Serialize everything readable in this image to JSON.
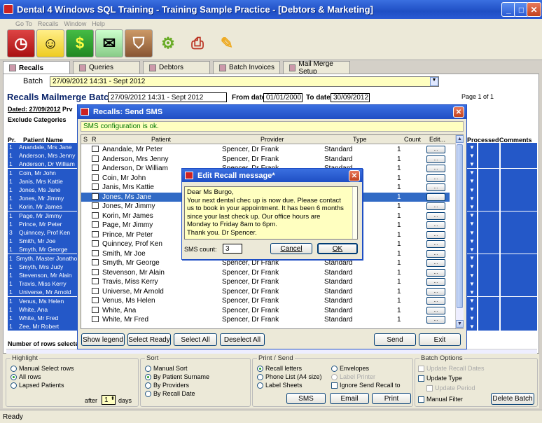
{
  "window": {
    "title": "Dental 4 Windows SQL Training - Training Sample Practice - [Debtors & Marketing]",
    "menu": [
      "Go To",
      "Recalls",
      "Window",
      "Help"
    ]
  },
  "tabs": [
    {
      "label": "Recalls",
      "active": true
    },
    {
      "label": "Queries"
    },
    {
      "label": "Debtors"
    },
    {
      "label": "Batch Invoices"
    },
    {
      "label": "Mail Merge Setup"
    }
  ],
  "batch": {
    "label": "Batch",
    "value": "27/09/2012 14:31 - Sept 2012"
  },
  "heading": {
    "title": "Recalls Mailmerge Batch",
    "value": "27/09/2012 14:31 - Sept 2012",
    "from_label": "From date",
    "from_value": "01/01/2000",
    "to_label": "To date",
    "to_value": "30/09/2012",
    "page": "Page 1 of 1",
    "dated": "Dated: 27/09/2012",
    "prv": "Prv",
    "exclude": "Exclude Categories",
    "rows_label": "Number of rows selected"
  },
  "bg_table": {
    "headers": {
      "pr": "Pr.",
      "name": "Patient Name",
      "processed": "Processed",
      "comments": "Comments"
    },
    "rows": [
      {
        "n": "1",
        "name": "Anandale, Mrs Jane"
      },
      {
        "n": "1",
        "name": "Anderson, Mrs Jenny"
      },
      {
        "n": "1",
        "name": "Anderson, Dr William"
      },
      {
        "n": "1",
        "name": "Coin, Mr John"
      },
      {
        "n": "1",
        "name": "Janis, Mrs Kattie"
      },
      {
        "n": "1",
        "name": "Jones, Ms Jane"
      },
      {
        "n": "1",
        "name": "Jones, Mr Jimmy"
      },
      {
        "n": "1",
        "name": "Korin, Mr James"
      },
      {
        "n": "1",
        "name": "Page, Mr Jimmy"
      },
      {
        "n": "1",
        "name": "Prince, Mr Peter"
      },
      {
        "n": "3",
        "name": "Quinncey, Prof Ken"
      },
      {
        "n": "1",
        "name": "Smith, Mr Joe"
      },
      {
        "n": "1",
        "name": "Smyth, Mr George"
      },
      {
        "n": "1",
        "name": "Smyth, Master Jonathon"
      },
      {
        "n": "1",
        "name": "Smyth, Mrs Judy"
      },
      {
        "n": "1",
        "name": "Stevenson, Mr Alain"
      },
      {
        "n": "1",
        "name": "Travis, Miss Kerry"
      },
      {
        "n": "1",
        "name": "Universe, Mr Arnold"
      },
      {
        "n": "1",
        "name": "Venus, Ms Helen"
      },
      {
        "n": "1",
        "name": "White, Ana"
      },
      {
        "n": "1",
        "name": "White, Mr Fred"
      },
      {
        "n": "1",
        "name": "Zee, Mr Robert"
      }
    ]
  },
  "sms_dialog": {
    "title": "Recalls: Send SMS",
    "status": "SMS configuration is ok.",
    "headers": {
      "s": "S",
      "r": "R",
      "patient": "Patient",
      "provider": "Provider",
      "type": "Type",
      "count": "Count",
      "edit": "Edit..."
    },
    "edit_label": "...",
    "rows": [
      {
        "patient": "Anandale, Mr Peter",
        "provider": "Spencer, Dr Frank",
        "type": "Standard",
        "count": "1"
      },
      {
        "patient": "Anderson, Mrs Jenny",
        "provider": "Spencer, Dr Frank",
        "type": "Standard",
        "count": "1"
      },
      {
        "patient": "Anderson, Dr William",
        "provider": "Spencer, Dr Frank",
        "type": "Standard",
        "count": "1"
      },
      {
        "patient": "Coin, Mr John",
        "provider": "",
        "type": "",
        "count": "1"
      },
      {
        "patient": "Janis, Mrs Kattie",
        "provider": "",
        "type": "",
        "count": "1"
      },
      {
        "patient": "Jones, Ms Jane",
        "provider": "",
        "type": "",
        "count": "1",
        "selected": true
      },
      {
        "patient": "Jones, Mr Jimmy",
        "provider": "",
        "type": "",
        "count": "1"
      },
      {
        "patient": "Korin, Mr James",
        "provider": "",
        "type": "",
        "count": "1"
      },
      {
        "patient": "Page, Mr Jimmy",
        "provider": "",
        "type": "",
        "count": "1"
      },
      {
        "patient": "Prince, Mr Peter",
        "provider": "",
        "type": "",
        "count": "1"
      },
      {
        "patient": "Quinncey, Prof Ken",
        "provider": "",
        "type": "",
        "count": "1"
      },
      {
        "patient": "Smith, Mr Joe",
        "provider": "",
        "type": "",
        "count": "1"
      },
      {
        "patient": "Smyth, Mr George",
        "provider": "Spencer, Dr Frank",
        "type": "Standard",
        "count": "1"
      },
      {
        "patient": "Stevenson, Mr Alain",
        "provider": "Spencer, Dr Frank",
        "type": "Standard",
        "count": "1"
      },
      {
        "patient": "Travis, Miss Kerry",
        "provider": "Spencer, Dr Frank",
        "type": "Standard",
        "count": "1"
      },
      {
        "patient": "Universe, Mr Arnold",
        "provider": "Spencer, Dr Frank",
        "type": "Standard",
        "count": "1"
      },
      {
        "patient": "Venus, Ms Helen",
        "provider": "Spencer, Dr Frank",
        "type": "Standard",
        "count": "1"
      },
      {
        "patient": "White, Ana",
        "provider": "Spencer, Dr Frank",
        "type": "Standard",
        "count": "1"
      },
      {
        "patient": "White, Mr Fred",
        "provider": "Spencer, Dr Frank",
        "type": "Standard",
        "count": "1"
      }
    ],
    "buttons": {
      "legend": "Show legend",
      "select_ready": "Select Ready",
      "select_all": "Select All",
      "deselect_all": "Deselect All",
      "send": "Send",
      "exit": "Exit"
    }
  },
  "edit_dialog": {
    "title": "Edit Recall message*",
    "message": "Dear Ms Burgo,\nYour next dental chec up is now due. Please contact\nus to book in your appointment. It has been 6 months\nsince your last check up. Our office hours are\nMonday to Friday 8am to 6pm.\nThank you. Dr Spencer.",
    "count_label": "SMS count:",
    "count_value": "3",
    "cancel": "Cancel",
    "ok": "OK"
  },
  "options": {
    "highlight": {
      "title": "Highlight",
      "items": [
        "Manual Select rows",
        "All rows",
        "Lapsed Patients"
      ],
      "selected": 1,
      "after": "after",
      "after_value": "1",
      "days": "days"
    },
    "sort": {
      "title": "Sort",
      "items": [
        "Manual Sort",
        "By Patient Surname",
        "By Providers",
        "By Recall Date"
      ],
      "selected": 1
    },
    "print": {
      "title": "Print / Send",
      "items": [
        "Recall letters",
        "Phone List (A4 size)",
        "Label Sheets"
      ],
      "selected": 0,
      "right": [
        "Envelopes",
        "Label Printer"
      ],
      "ignore": "Ignore Send Recall to",
      "sms": "SMS",
      "email": "Email",
      "print": "Print"
    },
    "batch": {
      "title": "Batch Options",
      "update_dates": "Update Recall Dates",
      "update_type": "Update Type",
      "update_period": "Update Period",
      "manual_filter": "Manual Filter",
      "delete": "Delete Batch"
    }
  },
  "status": "Ready"
}
